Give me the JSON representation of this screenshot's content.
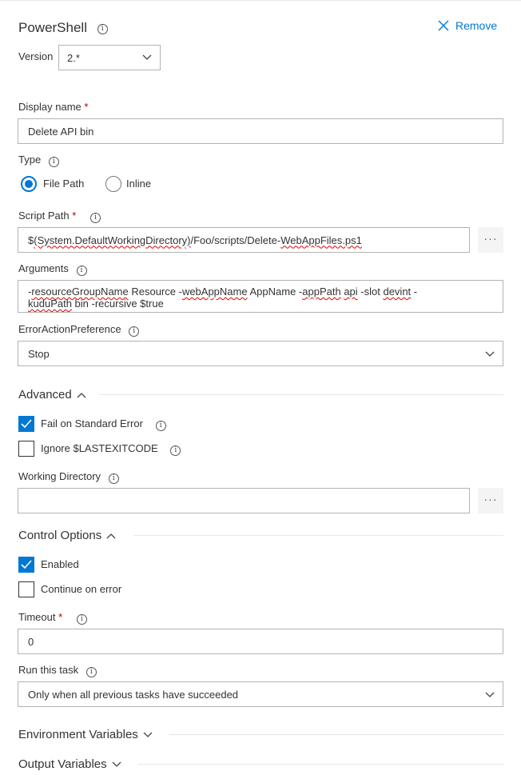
{
  "header": {
    "title": "PowerShell",
    "remove_label": "Remove"
  },
  "version": {
    "label": "Version",
    "value": "2.*"
  },
  "display_name": {
    "label": "Display name",
    "required": "*",
    "value": "Delete API bin"
  },
  "type": {
    "label": "Type",
    "options": [
      "File Path",
      "Inline"
    ],
    "selected": "File Path"
  },
  "script_path": {
    "label": "Script Path",
    "required": "*",
    "value_parts": [
      "$",
      "(System.DefaultWorkingDirectory)",
      "/Foo/scripts/Delete-",
      "WebAppFiles.ps1"
    ],
    "browse": "···"
  },
  "arguments": {
    "label": "Arguments",
    "line1_parts": [
      "-",
      "resourceGroupName",
      " Resource -",
      "webAppName",
      " AppName -",
      "appPath",
      " ",
      "api",
      " -slot ",
      "devint",
      " -"
    ],
    "line2_parts": [
      "kuduPath",
      " bin -recursive $true"
    ]
  },
  "error_action": {
    "label": "ErrorActionPreference",
    "value": "Stop"
  },
  "advanced": {
    "title": "Advanced",
    "fail_on_stderr": {
      "label": "Fail on Standard Error",
      "checked": true
    },
    "ignore_exit": {
      "label": "Ignore $LASTEXITCODE",
      "checked": false
    },
    "working_dir": {
      "label": "Working Directory",
      "value": "",
      "browse": "···"
    }
  },
  "control_options": {
    "title": "Control Options",
    "enabled": {
      "label": "Enabled",
      "checked": true
    },
    "continue_on_error": {
      "label": "Continue on error",
      "checked": false
    },
    "timeout": {
      "label": "Timeout",
      "required": "*",
      "value": "0"
    },
    "run_this_task": {
      "label": "Run this task",
      "value": "Only when all previous tasks have succeeded"
    }
  },
  "env_vars": {
    "title": "Environment Variables"
  },
  "output_vars": {
    "title": "Output Variables"
  },
  "colors": {
    "accent": "#0078d4",
    "required": "#a80000",
    "border": "#b3b3b3"
  }
}
